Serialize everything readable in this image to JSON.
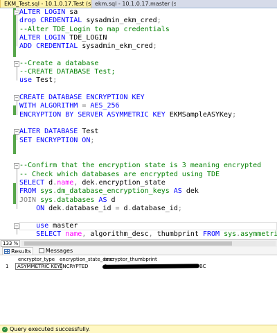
{
  "tabs": [
    {
      "title": "EKM_Test.sql - 10.1.0.17.Test (sa (58))*",
      "close": "✕",
      "active": true
    },
    {
      "title": "ekm.sql - 10.1.0.17.master (sa (53))",
      "close": "",
      "active": false
    }
  ],
  "editor": {
    "lines": [
      [
        {
          "t": "ALTER LOGIN ",
          "c": "kw"
        },
        {
          "t": "sa",
          "c": "pl"
        }
      ],
      [
        {
          "t": "drop CREDENTIAL ",
          "c": "kw"
        },
        {
          "t": "sysadmin_ekm_cred",
          "c": "pl"
        },
        {
          "t": ";",
          "c": "gr"
        }
      ],
      [
        {
          "t": "--Alter TDE_Login to map credentials",
          "c": "cm"
        }
      ],
      [
        {
          "t": "ALTER LOGIN ",
          "c": "kw"
        },
        {
          "t": "TDE_LOGIN",
          "c": "pl"
        }
      ],
      [
        {
          "t": "ADD CREDENTIAL ",
          "c": "kw"
        },
        {
          "t": "sysadmin_ekm_cred",
          "c": "pl"
        },
        {
          "t": ";",
          "c": "gr"
        }
      ],
      [],
      [
        {
          "t": "--Create a database",
          "c": "cm"
        }
      ],
      [
        {
          "t": "--CREATE DATABASE Test;",
          "c": "cm"
        }
      ],
      [
        {
          "t": "use ",
          "c": "kw"
        },
        {
          "t": "Test",
          "c": "pl"
        },
        {
          "t": ";",
          "c": "gr"
        }
      ],
      [],
      [
        {
          "t": "CREATE DATABASE ENCRYPTION KEY",
          "c": "kw"
        }
      ],
      [
        {
          "t": "WITH ALGORITHM ",
          "c": "kw"
        },
        {
          "t": "= ",
          "c": "gr"
        },
        {
          "t": "AES_256",
          "c": "kw"
        }
      ],
      [
        {
          "t": "ENCRYPTION BY SERVER ASYMMETRIC KEY ",
          "c": "kw"
        },
        {
          "t": "EKMSampleASYKey",
          "c": "pl"
        },
        {
          "t": ";",
          "c": "gr"
        }
      ],
      [],
      [
        {
          "t": "ALTER DATABASE ",
          "c": "kw"
        },
        {
          "t": "Test",
          "c": "pl"
        }
      ],
      [
        {
          "t": "SET ENCRYPTION ON",
          "c": "kw"
        },
        {
          "t": ";",
          "c": "gr"
        }
      ],
      [],
      [],
      [
        {
          "t": "--Confirm that the encryption state is 3 meaning encrypted",
          "c": "cm"
        }
      ],
      [
        {
          "t": "-- Check which databases are encrypted using TDE",
          "c": "cm"
        }
      ],
      [
        {
          "t": "SELECT ",
          "c": "kw"
        },
        {
          "t": "d",
          "c": "pl"
        },
        {
          "t": ".",
          "c": "gr"
        },
        {
          "t": "name",
          "c": "fn"
        },
        {
          "t": ", ",
          "c": "gr"
        },
        {
          "t": "dek",
          "c": "pl"
        },
        {
          "t": ".",
          "c": "gr"
        },
        {
          "t": "encryption_state",
          "c": "pl"
        }
      ],
      [
        {
          "t": "FROM ",
          "c": "kw"
        },
        {
          "t": "sys",
          "c": "sy"
        },
        {
          "t": ".",
          "c": "gr"
        },
        {
          "t": "dm_database_encryption_keys ",
          "c": "sy"
        },
        {
          "t": "AS ",
          "c": "kw"
        },
        {
          "t": "dek",
          "c": "pl"
        }
      ],
      [
        {
          "t": "JOIN ",
          "c": "gr"
        },
        {
          "t": "sys",
          "c": "sy"
        },
        {
          "t": ".",
          "c": "gr"
        },
        {
          "t": "databases ",
          "c": "sy"
        },
        {
          "t": "AS ",
          "c": "kw"
        },
        {
          "t": "d",
          "c": "pl"
        }
      ],
      [
        {
          "t": "    ON ",
          "c": "kw"
        },
        {
          "t": "dek",
          "c": "pl"
        },
        {
          "t": ".",
          "c": "gr"
        },
        {
          "t": "database_id ",
          "c": "pl"
        },
        {
          "t": "= ",
          "c": "gr"
        },
        {
          "t": "d",
          "c": "pl"
        },
        {
          "t": ".",
          "c": "gr"
        },
        {
          "t": "database_id",
          "c": "pl"
        },
        {
          "t": ";",
          "c": "gr"
        }
      ],
      [],
      [
        {
          "t": "    use ",
          "c": "kw"
        },
        {
          "t": "master",
          "c": "pl"
        }
      ],
      [
        {
          "t": "    SELECT ",
          "c": "kw"
        },
        {
          "t": "name",
          "c": "fn"
        },
        {
          "t": ", ",
          "c": "gr"
        },
        {
          "t": "algorithm_desc",
          "c": "pl"
        },
        {
          "t": ", ",
          "c": "gr"
        },
        {
          "t": "thumbprint ",
          "c": "pl"
        },
        {
          "t": "FROM ",
          "c": "kw"
        },
        {
          "t": "sys",
          "c": "sy"
        },
        {
          "t": ".",
          "c": "gr"
        },
        {
          "t": "asymmetric_keys",
          "c": "sy"
        },
        {
          "t": ";",
          "c": "gr"
        }
      ]
    ]
  },
  "zoom": "133 %",
  "results_tabs": [
    {
      "label": "Results",
      "icon": "grid-icon",
      "active": true
    },
    {
      "label": "Messages",
      "icon": "message-icon",
      "active": false
    }
  ],
  "grid": {
    "columns": [
      "encryptor_type",
      "encryption_state_desc",
      "encryptor_thumbprint"
    ],
    "rows": [
      {
        "num": "1",
        "cells": [
          "ASYMMETRIC KEY",
          "ENCRYPTED",
          "0x",
          "BC"
        ]
      }
    ]
  },
  "status": {
    "icon": "success-icon",
    "text": "Query executed successfully."
  },
  "colors": {
    "keyword": "#0000ff",
    "comment": "#008000",
    "function": "#ff00ff",
    "active_tab": "#fff3a8",
    "status_bar": "#fff8c4"
  }
}
